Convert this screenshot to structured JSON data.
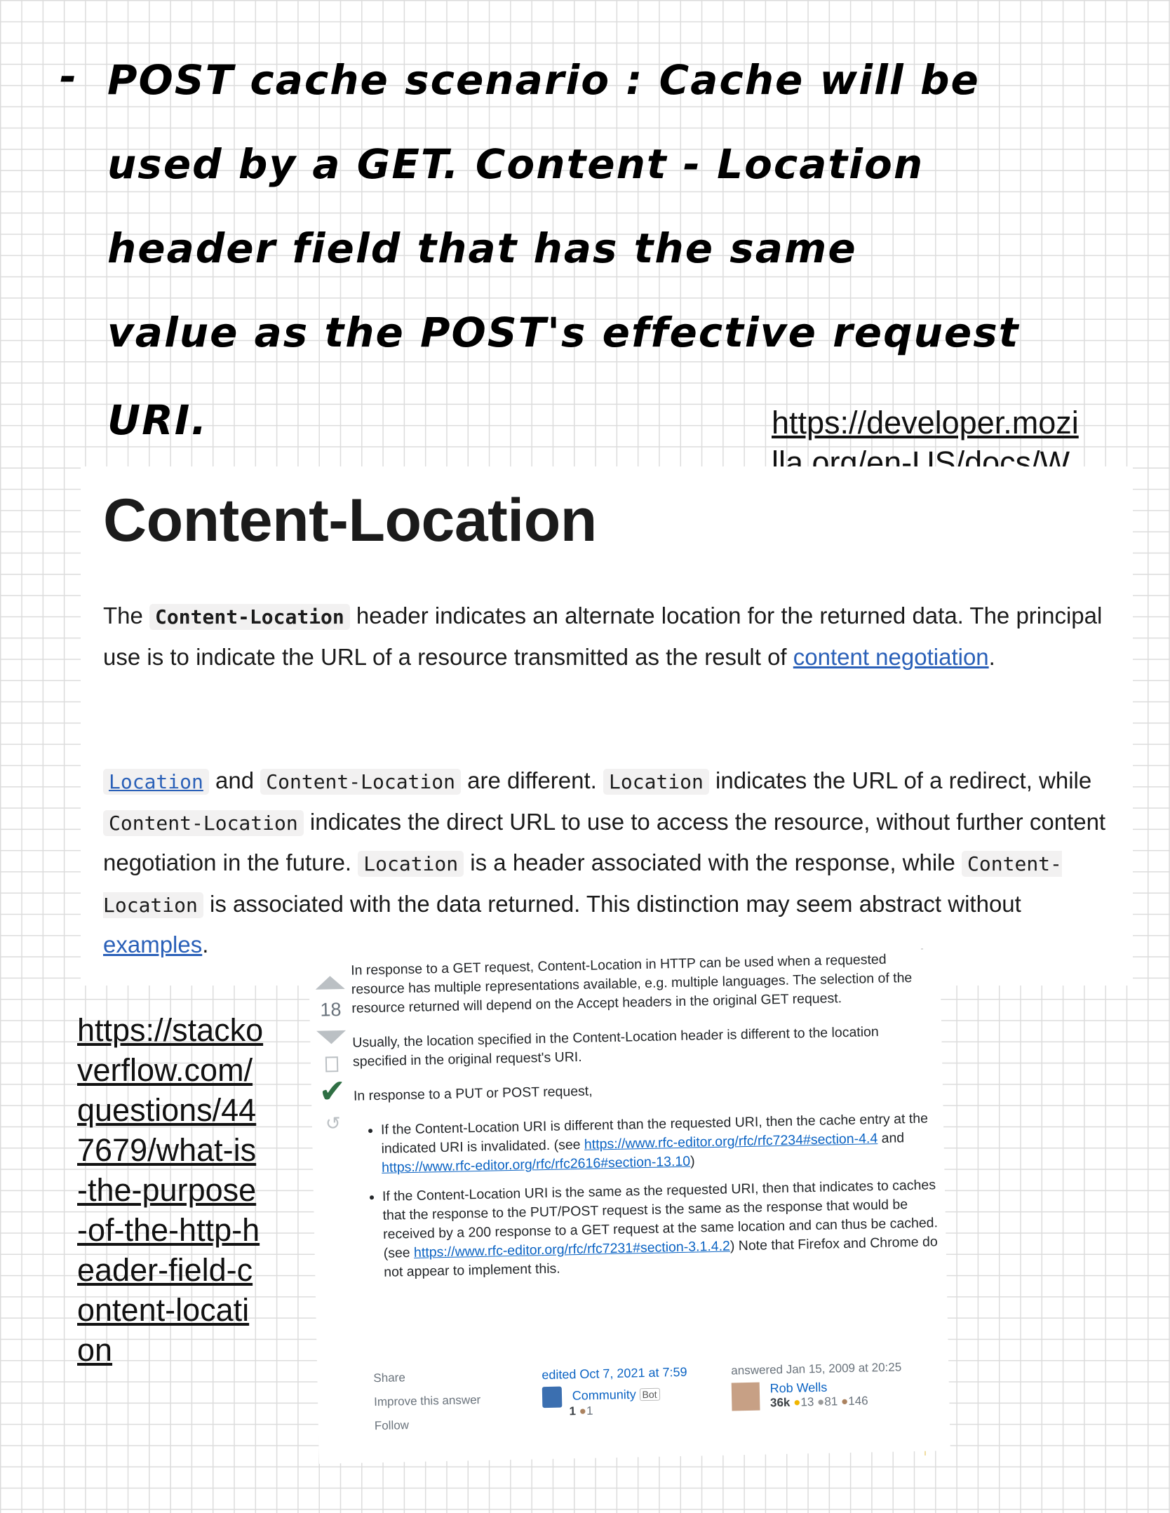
{
  "handwritten_note": {
    "dash": "-",
    "lines": [
      "POST  cache  scenario : Cache  will  be",
      "used  by a  GET.  Content - Location",
      "header  field  that has  the  same",
      "value  as the  POST's  effective  request",
      "URI."
    ]
  },
  "mdn_url": "https://developer.mozilla.org/en-US/docs/Web/HTTP/Headers/Content-Location",
  "so_url": "https://stackoverflow.com/questions/447679/what-is-the-purpose-of-the-http-header-field-content-location",
  "mdn": {
    "title": "Content-Location",
    "p1": {
      "t1": "The ",
      "code1": "Content-Location",
      "t2": " header indicates an alternate location for the returned data. The principal use is to indicate the URL of a resource transmitted as the result of ",
      "link": "content negotiation",
      "t3": "."
    },
    "p2": {
      "code_location_link": "Location",
      "t1": " and ",
      "code2": "Content-Location",
      "t2": " are different. ",
      "code3": "Location",
      "t3": " indicates the URL of a redirect, while ",
      "code4": "Content-Location",
      "t4": " indicates the direct URL to use to access the resource, without further content negotiation in the future. ",
      "code5": "Location",
      "t5": " is a header associated with the response, while ",
      "code6": "Content-Location",
      "t6": " is associated with the data returned. This distinction may seem abstract without ",
      "link": "examples",
      "t7": "."
    }
  },
  "so_answer": {
    "vote_count": "18",
    "p1": "In response to a GET request, Content-Location in HTTP can be used when a requested resource has multiple representations available, e.g. multiple languages. The selection of the resource returned will depend on the Accept headers in the original GET request.",
    "p2": "Usually, the location specified in the Content-Location header is different to the location specified in the original request's URI.",
    "p3": "In response to a PUT or POST request,",
    "bullet1": {
      "t1": "If the Content-Location URI is different than the requested URI, then the cache entry at the indicated URI is invalidated. (see ",
      "link1": "https://www.rfc-editor.org/rfc/rfc7234#section-4.4",
      "t2": " and ",
      "link2": "https://www.rfc-editor.org/rfc/rfc2616#section-13.10",
      "t3": ")"
    },
    "bullet2": {
      "t1": "If the Content-Location URI is the same as the requested URI, then that indicates to caches that the response to the PUT/POST request is the same as the response that would be received by a 200 response to a GET request at the same location and can thus be cached. (see ",
      "link1": "https://www.rfc-editor.org/rfc/rfc7231#section-3.1.4.2",
      "t2": ") Note that Firefox and Chrome do not appear to implement this."
    },
    "menu": [
      "Share",
      "Improve this answer",
      "Follow"
    ],
    "edited": {
      "label": "edited Oct 7, 2021 at 7:59",
      "user": "Community",
      "badge": "Bot",
      "rep": "1",
      "bronze": "1"
    },
    "answered": {
      "label": "answered Jan 15, 2009 at 20:25",
      "user": "Rob Wells",
      "rep": "36k",
      "gold": "13",
      "silver": "81",
      "bronze": "146"
    }
  }
}
